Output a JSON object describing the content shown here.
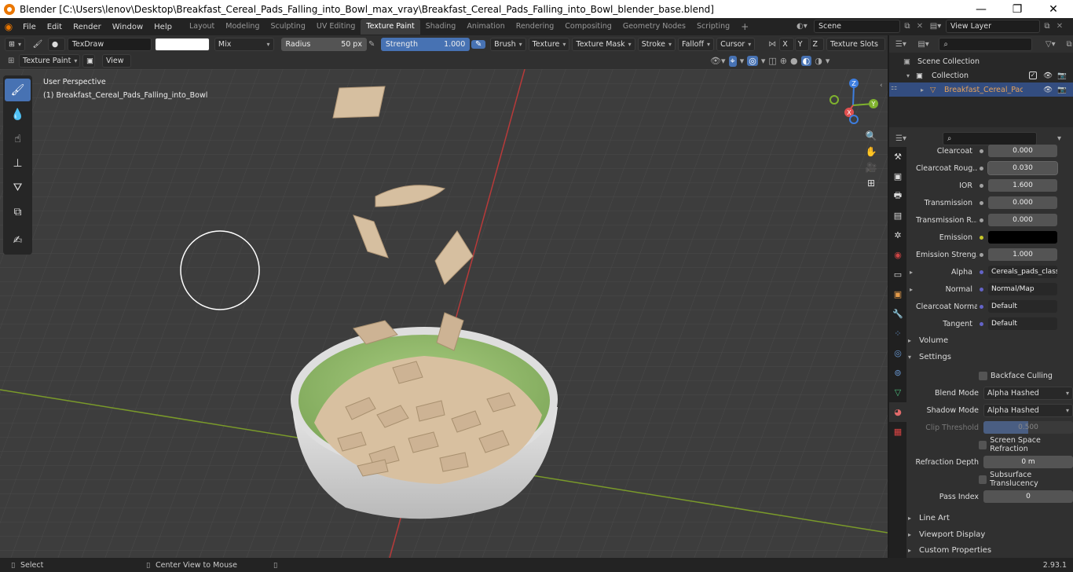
{
  "title": "Blender [C:\\Users\\lenov\\Desktop\\Breakfast_Cereal_Pads_Falling_into_Bowl_max_vray\\Breakfast_Cereal_Pads_Falling_into_Bowl_blender_base.blend]",
  "menu": [
    "File",
    "Edit",
    "Render",
    "Window",
    "Help"
  ],
  "workspaces": [
    "Layout",
    "Modeling",
    "Sculpting",
    "UV Editing",
    "Texture Paint",
    "Shading",
    "Animation",
    "Rendering",
    "Compositing",
    "Geometry Nodes",
    "Scripting"
  ],
  "active_workspace_index": 4,
  "scene_label": "Scene",
  "view_layer_label": "View Layer",
  "tool": {
    "brush_name": "TexDraw",
    "blend": "Mix",
    "radius_label": "Radius",
    "radius_value": "50 px",
    "strength_label": "Strength",
    "strength_value": "1.000",
    "strength_fraction": 1.0,
    "menus": [
      "Brush",
      "Texture",
      "Texture Mask",
      "Stroke",
      "Falloff",
      "Cursor"
    ],
    "axes": [
      "X",
      "Y",
      "Z"
    ],
    "texture_slots": "Texture Slots"
  },
  "mode": {
    "label": "Texture Paint",
    "view": "View"
  },
  "viewport": {
    "perspective": "User Perspective",
    "object_line": "(1) Breakfast_Cereal_Pads_Falling_into_Bowl",
    "gizmo": {
      "x": "X",
      "y": "Y",
      "z": "Z"
    }
  },
  "outliner": {
    "scene_collection": "Scene Collection",
    "collection": "Collection",
    "object": "Breakfast_Cereal_Pads_I"
  },
  "properties": {
    "rows": [
      {
        "label": "Clearcoat",
        "value": "0.000",
        "socket": "#a1a1a1"
      },
      {
        "label": "Clearcoat Roug...",
        "value": "0.030",
        "socket": "#a1a1a1"
      },
      {
        "label": "IOR",
        "value": "1.600",
        "socket": "#a1a1a1"
      },
      {
        "label": "Transmission",
        "value": "0.000",
        "socket": "#a1a1a1"
      },
      {
        "label": "Transmission R...",
        "value": "0.000",
        "socket": "#a1a1a1"
      },
      {
        "label": "Emission",
        "value": "",
        "socket": "#c7c729"
      },
      {
        "label": "Emission Streng...",
        "value": "1.000",
        "socket": "#a1a1a1"
      },
      {
        "label": "Alpha",
        "value": "Cereals_pads_classi...",
        "socket": "#6363c7"
      },
      {
        "label": "Normal",
        "value": "Normal/Map",
        "socket": "#6363c7"
      },
      {
        "label": "Clearcoat Normal",
        "value": "Default",
        "socket": "#6363c7"
      },
      {
        "label": "Tangent",
        "value": "Default",
        "socket": "#6363c7"
      }
    ],
    "volume": "Volume",
    "settings": "Settings",
    "backface_culling": "Backface Culling",
    "blend_mode_label": "Blend Mode",
    "blend_mode": "Alpha Hashed",
    "shadow_mode_label": "Shadow Mode",
    "shadow_mode": "Alpha Hashed",
    "clip_threshold_label": "Clip Threshold",
    "clip_threshold": "0.500",
    "screen_space_refraction": "Screen Space Refraction",
    "refraction_depth_label": "Refraction Depth",
    "refraction_depth": "0 m",
    "subsurface_translucency": "Subsurface Translucency",
    "pass_index_label": "Pass Index",
    "pass_index": "0",
    "line_art": "Line Art",
    "viewport_display": "Viewport Display",
    "custom_properties": "Custom Properties"
  },
  "status": {
    "select": "Select",
    "center_view": "Center View to Mouse",
    "version": "2.93.1"
  },
  "colors": {
    "accent": "#4772b3",
    "emission": "#000000",
    "bowl_inner": "#8fb56a"
  }
}
